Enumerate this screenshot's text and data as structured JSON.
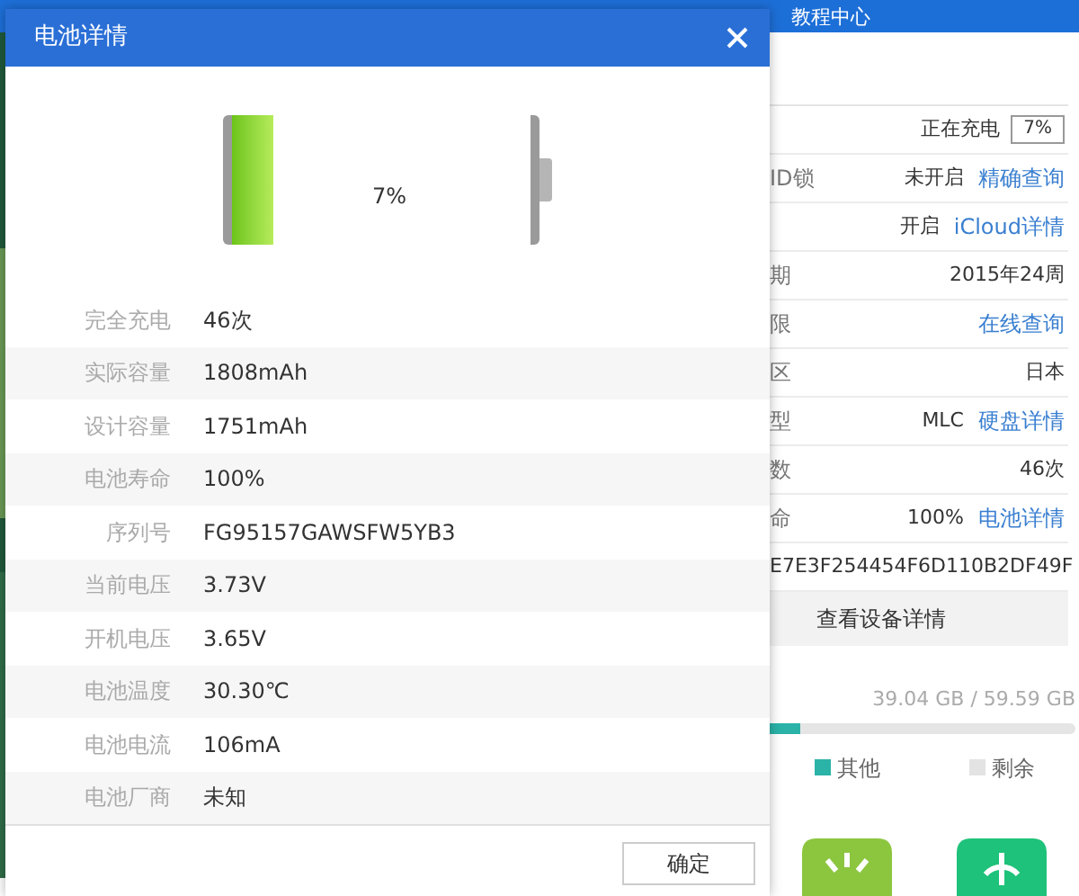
{
  "top_nav": {
    "items": [
      "教程中心"
    ]
  },
  "device_panel": {
    "rows": [
      {
        "label": "",
        "value": "正在充电",
        "badge": "7%"
      },
      {
        "label": "ID锁",
        "value": "未开启",
        "link": "精确查询"
      },
      {
        "label": "",
        "value": "开启",
        "link": "iCloud详情"
      },
      {
        "label": "期",
        "value": "2015年24周"
      },
      {
        "label": "限",
        "link": "在线查询"
      },
      {
        "label": "区",
        "value": "日本"
      },
      {
        "label": "型",
        "value": "MLC",
        "link": "硬盘详情"
      },
      {
        "label": "数",
        "value": "46次"
      },
      {
        "label": "命",
        "value": "100%",
        "link": "电池详情"
      },
      {
        "label": "",
        "value": "E7E3F254454F6D110B2DF49F"
      }
    ],
    "details_button": "查看设备详情"
  },
  "storage": {
    "reading": "39.04 GB / 59.59 GB",
    "level": 0.1,
    "legend": [
      {
        "label": "其他",
        "color": "#2bb3a8"
      },
      {
        "label": "剩余",
        "color": "#e3e3e3"
      }
    ]
  },
  "dialog": {
    "title": "电池详情",
    "battery": {
      "level": 0.07,
      "reading": "7%"
    },
    "rows": [
      {
        "label": "完全充电",
        "value": "46次"
      },
      {
        "label": "实际容量",
        "value": "1808mAh"
      },
      {
        "label": "设计容量",
        "value": "1751mAh"
      },
      {
        "label": "电池寿命",
        "value": "100%"
      },
      {
        "label": "序列号",
        "value": "FG95157GAWSFW5YB3"
      },
      {
        "label": "当前电压",
        "value": "3.73V"
      },
      {
        "label": "开机电压",
        "value": "3.65V"
      },
      {
        "label": "电池温度",
        "value": "30.30℃"
      },
      {
        "label": "电池电流",
        "value": "106mA"
      },
      {
        "label": "电池厂商",
        "value": "未知"
      }
    ],
    "ok_button": "确定"
  }
}
